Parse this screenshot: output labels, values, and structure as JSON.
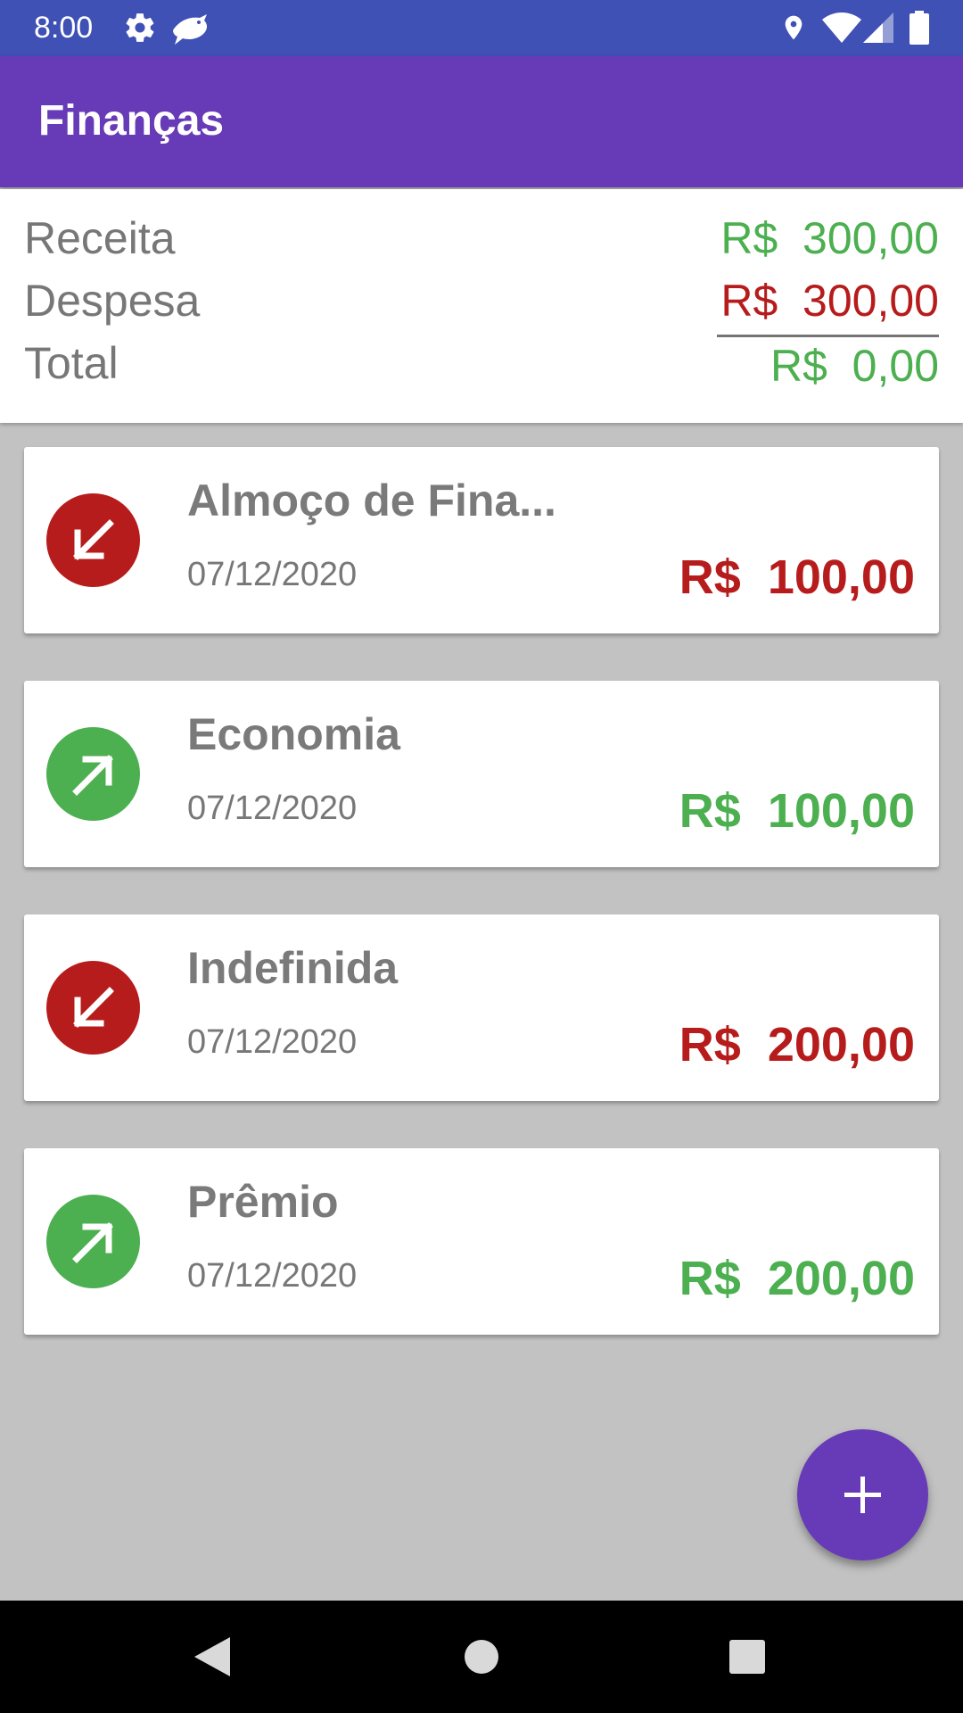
{
  "status_bar": {
    "time": "8:00",
    "icons": [
      "gear-icon",
      "bird-icon",
      "location-icon",
      "wifi-icon",
      "signal-icon",
      "battery-icon"
    ]
  },
  "app_bar": {
    "title": "Finanças",
    "background": "#673ab7"
  },
  "summary": {
    "income_label": "Receita",
    "income_value": "R$  300,00",
    "expense_label": "Despesa",
    "expense_value": "R$  300,00",
    "total_label": "Total",
    "total_value": "R$  0,00"
  },
  "colors": {
    "income": "#4caf50",
    "expense": "#b71c1c",
    "accent": "#673ab7",
    "status_bar": "#3f51b5"
  },
  "transactions": [
    {
      "title": "Almoço de Fina...",
      "date": "07/12/2020",
      "value": "R$  100,00",
      "kind": "expense",
      "icon": "arrow-down-left-icon"
    },
    {
      "title": "Economia",
      "date": "07/12/2020",
      "value": "R$  100,00",
      "kind": "income",
      "icon": "arrow-up-right-icon"
    },
    {
      "title": "Indefinida",
      "date": "07/12/2020",
      "value": "R$  200,00",
      "kind": "expense",
      "icon": "arrow-down-left-icon"
    },
    {
      "title": "Prêmio",
      "date": "07/12/2020",
      "value": "R$  200,00",
      "kind": "income",
      "icon": "arrow-up-right-icon"
    }
  ],
  "fab": {
    "icon": "plus-icon"
  },
  "nav_bar": {
    "buttons": [
      "back-icon",
      "home-icon",
      "recents-icon"
    ]
  }
}
